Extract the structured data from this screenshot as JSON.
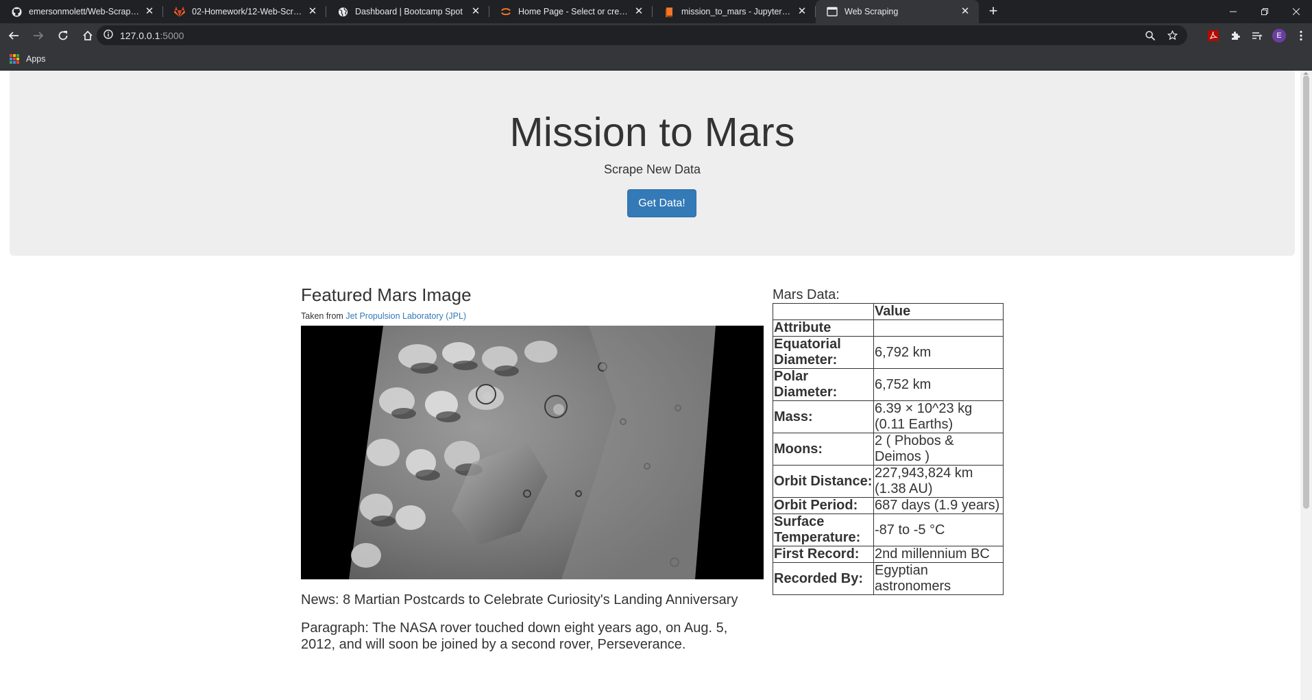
{
  "browser": {
    "tabs": [
      {
        "title": "emersonmolett/Web-Scraping-Challenge",
        "favicon": "github-icon",
        "active": false
      },
      {
        "title": "02-Homework/12-Web-Scraping-and-Document-Databases",
        "favicon": "gitlab-icon",
        "active": false
      },
      {
        "title": "Dashboard | Bootcamp Spot",
        "favicon": "globe-icon",
        "active": false
      },
      {
        "title": "Home Page - Select or create a notebook",
        "favicon": "jupyter-icon",
        "active": false
      },
      {
        "title": "mission_to_mars - Jupyter Notebook",
        "favicon": "notebook-icon",
        "active": false
      },
      {
        "title": "Web Scraping",
        "favicon": "page-icon",
        "active": true
      }
    ],
    "url_host": "127.0.0.1",
    "url_port": ":5000",
    "bookmarks": {
      "apps_label": "Apps"
    },
    "profile_initial": "E"
  },
  "page": {
    "jumbotron": {
      "title": "Mission to Mars",
      "subtitle": "Scrape New Data",
      "button_label": "Get Data!"
    },
    "featured": {
      "heading": "Featured Mars Image",
      "credit_prefix": "Taken from ",
      "credit_link": "Jet Propulsion Laboratory (JPL)"
    },
    "news": {
      "title": "News: 8 Martian Postcards to Celebrate Curiosity's Landing Anniversary",
      "paragraph": "Paragraph: The NASA rover touched down eight years ago, on Aug. 5, 2012, and will soon be joined by a second rover, Perseverance."
    },
    "facts": {
      "heading": "Mars Data:",
      "value_header": "Value",
      "attribute_header": "Attribute",
      "rows": [
        {
          "label": "Equatorial Diameter:",
          "value": "6,792 km"
        },
        {
          "label": "Polar Diameter:",
          "value": "6,752 km"
        },
        {
          "label": "Mass:",
          "value": "6.39 × 10^23 kg (0.11 Earths)"
        },
        {
          "label": "Moons:",
          "value": "2 ( Phobos & Deimos )"
        },
        {
          "label": "Orbit Distance:",
          "value": "227,943,824 km (1.38 AU)"
        },
        {
          "label": "Orbit Period:",
          "value": "687 days (1.9 years)"
        },
        {
          "label": "Surface Temperature:",
          "value": "-87 to -5 °C"
        },
        {
          "label": "First Record:",
          "value": "2nd millennium BC"
        },
        {
          "label": "Recorded By:",
          "value": "Egyptian astronomers"
        }
      ]
    }
  }
}
